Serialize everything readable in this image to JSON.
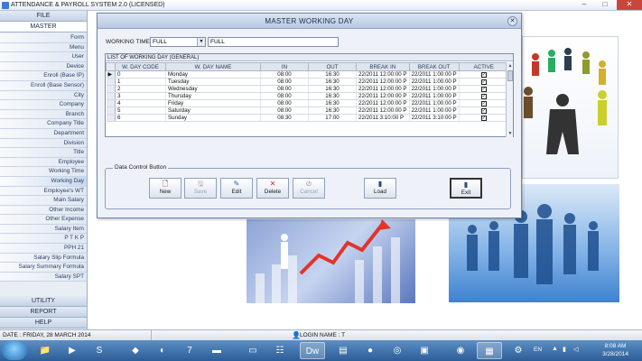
{
  "app": {
    "title": "ATTENDANCE & PAYROLL SYSTEM 2.0 (LICENSED)"
  },
  "window_controls": {
    "minimize": "–",
    "maximize": "□",
    "close": "✕"
  },
  "sidebar": {
    "file_label": "FILE",
    "master_label": "MASTER",
    "items": [
      "Form",
      "Menu",
      "User",
      "Device",
      "Enroll (Base IP)",
      "Enroll (Base Sensor)",
      "City",
      "Company",
      "Branch",
      "Company Title",
      "Department",
      "Division",
      "Title",
      "Employee",
      "Working Time",
      "Working Day",
      "Employee's WT",
      "Main Salary",
      "Other Income",
      "Other Expense",
      "Salary Item",
      "P T K P",
      "PPH 21",
      "Salary Slip Formula",
      "Salary Summary Formula",
      "Salary SPT"
    ],
    "selected": "Working Day",
    "bottom": [
      "UTILITY",
      "REPORT",
      "HELP"
    ]
  },
  "dialog": {
    "title": "MASTER WORKING DAY",
    "working_time_label": "WORKING TIME",
    "working_time_value": "FULL",
    "working_time_desc": "FULL",
    "grid_caption": "LIST OF WORKING DAY (GENERAL)",
    "columns": [
      "W. DAY CODE",
      "W. DAY NAME",
      "IN",
      "OUT",
      "BREAK IN",
      "BREAK OUT",
      "ACTIVE"
    ],
    "rows": [
      {
        "code": "0",
        "name": "Monday",
        "in": "08:00",
        "out": "16:30",
        "break_in": "22/2011 12:00:00 P",
        "break_out": "22/2011 1:00:00 P",
        "active": "✓"
      },
      {
        "code": "1",
        "name": "Tuesday",
        "in": "08:00",
        "out": "16:30",
        "break_in": "22/2011 12:00:00 P",
        "break_out": "22/2011 1:00:00 P",
        "active": "✓"
      },
      {
        "code": "2",
        "name": "Wednesday",
        "in": "08:00",
        "out": "16:30",
        "break_in": "22/2011 12:00:00 P",
        "break_out": "22/2011 1:00:00 P",
        "active": "✓"
      },
      {
        "code": "3",
        "name": "Thursday",
        "in": "08:00",
        "out": "16:30",
        "break_in": "22/2011 12:00:00 P",
        "break_out": "22/2011 1:00:00 P",
        "active": "✓"
      },
      {
        "code": "4",
        "name": "Friday",
        "in": "08:00",
        "out": "16:30",
        "break_in": "22/2011 12:00:00 P",
        "break_out": "22/2011 1:00:00 P",
        "active": "✓"
      },
      {
        "code": "5",
        "name": "Saturday",
        "in": "08:00",
        "out": "16:30",
        "break_in": "22/2011 12:00:00 P",
        "break_out": "22/2011 1:00:00 P",
        "active": "✓"
      },
      {
        "code": "6",
        "name": "Sunday",
        "in": "08:30",
        "out": "17:00",
        "break_in": "22/2011 3:10:00 P",
        "break_out": "22/2011 3:10:00 P",
        "active": "✓"
      }
    ],
    "control_caption": "Data Control Button",
    "buttons": {
      "new": "New",
      "save": "Save",
      "edit": "Edit",
      "delete": "Delete",
      "cancel": "Cancel",
      "load": "Load",
      "exit": "Exit"
    }
  },
  "status": {
    "date": "DATE : FRIDAY, 28 MARCH 2014",
    "login": "LOGIN NAME  : T"
  },
  "taskbar": {
    "lang": "EN",
    "time": "8:08 AM",
    "date": "3/28/2014"
  }
}
